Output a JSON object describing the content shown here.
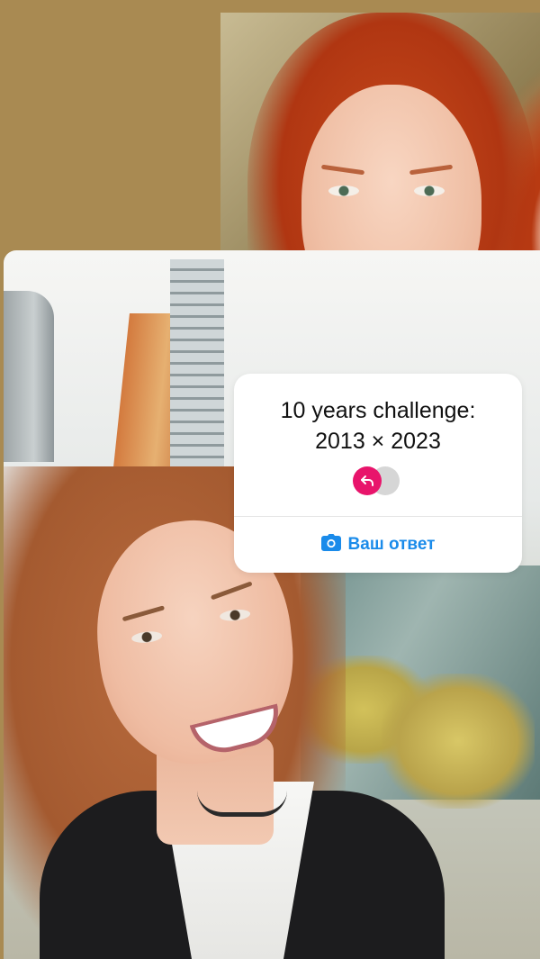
{
  "story": {
    "background_color": "#a98a52",
    "photos": [
      {
        "name": "portrait-2013",
        "description_icon": "portrait-photo"
      },
      {
        "name": "selfie-2023",
        "description_icon": "selfie-photo"
      }
    ]
  },
  "sticker": {
    "title_line1": "10 years challenge:",
    "title_line2": "2013 × 2023",
    "toggle_icon": "reply-arrow-icon",
    "toggle_color": "#e8146b",
    "reply_icon": "camera-icon",
    "reply_label": "Ваш ответ",
    "reply_color": "#1a8bea"
  }
}
